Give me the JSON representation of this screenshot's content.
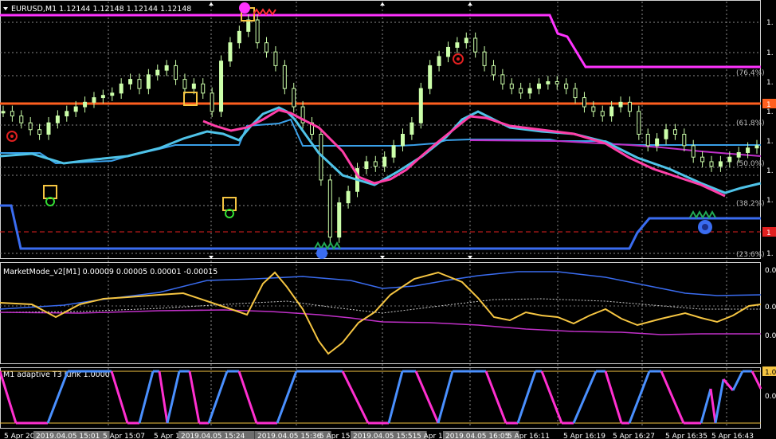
{
  "main": {
    "title": "EURUSD,M1  1.12144 1.12148 1.12144 1.12148",
    "fib": [
      "(76.4%)",
      "(61.8%)",
      "(50.0%)",
      "(38.2%)",
      "(23.6%)"
    ],
    "price_ticks": [
      "1.",
      "1.",
      "1.",
      "1.",
      "1.",
      "1.",
      "1.",
      "1."
    ],
    "badges": [
      "1",
      "1"
    ]
  },
  "mm": {
    "title": "MarketMode_v2[M1] 0.00009 0.00005 0.00001 -0.00015",
    "ticks": [
      "0.0",
      "0.0",
      "0.0"
    ]
  },
  "t3": {
    "title": "M1  adaptive T3 Jurik  1.0000",
    "ticks": [
      "1.0",
      "0.0"
    ]
  },
  "time_axis": [
    {
      "label": "5 Apr 201",
      "hl": false
    },
    {
      "label": "2019.04.05 15:01",
      "hl": true
    },
    {
      "label": "5 Apr 15:07",
      "hl": false
    },
    {
      "label": "5 Apr 1",
      "hl": false
    },
    {
      "label": "2019.04.05 15:24",
      "hl": true
    },
    {
      "label": "2019.04.05 15:36",
      "hl": true
    },
    {
      "label": "5 Apr 15:39",
      "hl": false
    },
    {
      "label": "2019.04.05 15:51",
      "hl": true
    },
    {
      "label": "5 Apr 15:",
      "hl": false
    },
    {
      "label": "2019.04.05 16:05",
      "hl": true
    },
    {
      "label": "5 Apr 16:11",
      "hl": false
    },
    {
      "label": "5 Apr 16:19",
      "hl": false
    },
    {
      "label": "5 Apr 16:27",
      "hl": false
    },
    {
      "label": "5 Apr 16:35",
      "hl": false
    },
    {
      "label": "5 Apr 16:43",
      "hl": false
    }
  ],
  "colors": {
    "bg": "#000000",
    "grid": "#7a7a7a",
    "text": "#ffffff",
    "candle": "#ccffaa",
    "magenta": "#ff33ff",
    "orange": "#ff5f1f",
    "blue_band": "#3a6cf0",
    "cyan": "#4fc3e8",
    "pink": "#ff3fa8",
    "yellow": "#f5c542",
    "t3_blue": "#4a90ff",
    "t3_magenta": "#ff2fd0"
  },
  "chart_data": {
    "type": "line",
    "note_free": true,
    "series": [
      {
        "name": "EURUSD,M1",
        "values": [
          0.6,
          0.58,
          0.55,
          0.52,
          0.5,
          0.55,
          0.58,
          0.6,
          0.62,
          0.64,
          0.66,
          0.67,
          0.68,
          0.72,
          0.74,
          0.7,
          0.76,
          0.78,
          0.8,
          0.74,
          0.7,
          0.72,
          0.68,
          0.6,
          0.82,
          0.9,
          0.95,
          1.0,
          0.9,
          0.86,
          0.8,
          0.7,
          0.62,
          0.55,
          0.5,
          0.3,
          0.05,
          0.2,
          0.25,
          0.35,
          0.38,
          0.36,
          0.4,
          0.45,
          0.5,
          0.55,
          0.7,
          0.8,
          0.84,
          0.88,
          0.9,
          0.92,
          0.86,
          0.8,
          0.76,
          0.72,
          0.7,
          0.68,
          0.7,
          0.72,
          0.73,
          0.72,
          0.7,
          0.66,
          0.62,
          0.6,
          0.58,
          0.62,
          0.64,
          0.6,
          0.5,
          0.45,
          0.48,
          0.52,
          0.5,
          0.45,
          0.4,
          0.38,
          0.36,
          0.38,
          0.4,
          0.42,
          0.44,
          0.45
        ]
      }
    ]
  }
}
